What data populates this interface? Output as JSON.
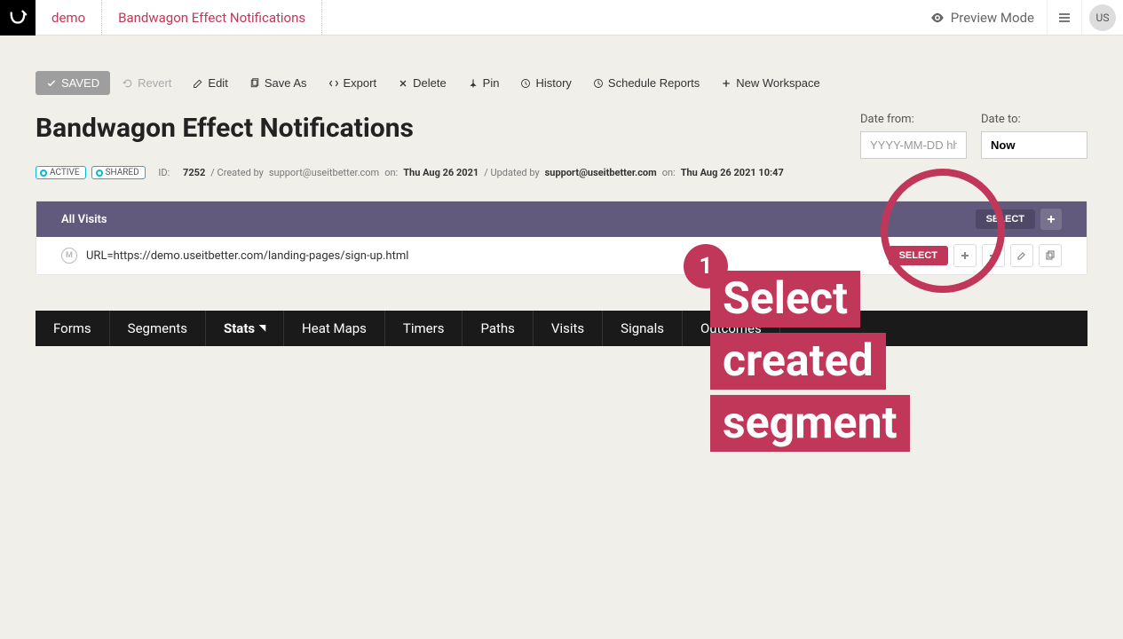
{
  "header": {
    "breadcrumb": [
      "demo",
      "Bandwagon Effect Notifications"
    ],
    "preview_mode": "Preview Mode",
    "user_initials": "US"
  },
  "toolbar": {
    "saved": "SAVED",
    "revert": "Revert",
    "edit": "Edit",
    "save_as": "Save As",
    "export": "Export",
    "delete": "Delete",
    "pin": "Pin",
    "history": "History",
    "schedule": "Schedule Reports",
    "new_workspace": "New Workspace"
  },
  "title": "Bandwagon Effect Notifications",
  "badges": {
    "active": "ACTIVE",
    "shared": "SHARED"
  },
  "meta": {
    "id_label": "ID:",
    "id": "7252",
    "created_by_label": "/ Created by",
    "created_by": "support@useitbetter.com",
    "created_on_label": "on:",
    "created_on": "Thu Aug 26 2021",
    "updated_by_label": "/ Updated by",
    "updated_by": "support@useitbetter.com",
    "updated_on_label": "on:",
    "updated_on": "Thu Aug 26 2021 10:47"
  },
  "date_filters": {
    "from_label": "Date from:",
    "from_placeholder": "YYYY-MM-DD hh:mm",
    "to_label": "Date to:",
    "to_value": "Now"
  },
  "segment": {
    "header_label": "All Visits",
    "select_label": "SELECT",
    "row_url": "URL=https://demo.useitbetter.com/landing-pages/sign-up.html",
    "m_badge": "M"
  },
  "tabs": [
    "Forms",
    "Segments",
    "Stats",
    "Heat Maps",
    "Timers",
    "Paths",
    "Visits",
    "Signals",
    "Outcomes"
  ],
  "tabs_active_index": 2,
  "annotation": {
    "number": "1",
    "line1": "Select",
    "line2": "created",
    "line3": "segment"
  }
}
